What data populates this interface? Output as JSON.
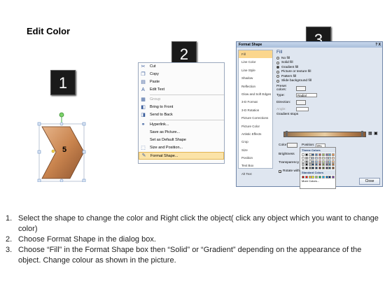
{
  "title": "Edit Color",
  "steps": [
    "1",
    "2",
    "3"
  ],
  "shape_label": "5",
  "context_menu": {
    "items": [
      {
        "label": "Cut",
        "icon": "scissors-icon",
        "disabled": false
      },
      {
        "label": "Copy",
        "icon": "copy-icon",
        "disabled": false
      },
      {
        "label": "Paste",
        "icon": "paste-icon",
        "disabled": false
      },
      {
        "label": "Edit Text",
        "icon": "edit-text-icon",
        "disabled": false
      },
      {
        "label": "Group",
        "icon": "group-icon",
        "disabled": true
      },
      {
        "label": "Bring to Front",
        "icon": "bring-front-icon",
        "disabled": false
      },
      {
        "label": "Send to Back",
        "icon": "send-back-icon",
        "disabled": false
      },
      {
        "label": "Hyperlink...",
        "icon": "hyperlink-icon",
        "disabled": false
      },
      {
        "label": "Save as Picture...",
        "icon": "",
        "disabled": false
      },
      {
        "label": "Set as Default Shape",
        "icon": "",
        "disabled": false
      },
      {
        "label": "Size and Position...",
        "icon": "size-icon",
        "disabled": false
      },
      {
        "label": "Format Shape...",
        "icon": "format-shape-icon",
        "disabled": false,
        "highlighted": true
      }
    ]
  },
  "dialog": {
    "title": "Format Shape",
    "controls": "? X",
    "left_items": [
      "Fill",
      "Line Color",
      "Line Style",
      "Shadow",
      "Reflection",
      "Glow and Soft Edges",
      "3-D Format",
      "3-D Rotation",
      "Picture Corrections",
      "Picture Color",
      "Artistic Effects",
      "Crop",
      "Size",
      "Position",
      "Text Box",
      "Alt Text"
    ],
    "section_heading": "Fill",
    "fill_options": [
      {
        "label": "No fill",
        "selected": false
      },
      {
        "label": "Solid fill",
        "selected": false
      },
      {
        "label": "Gradient fill",
        "selected": true
      },
      {
        "label": "Picture or texture fill",
        "selected": false
      },
      {
        "label": "Pattern fill",
        "selected": false
      },
      {
        "label": "Slide background fill",
        "selected": false
      }
    ],
    "preset_colors_label": "Preset colors:",
    "type_label": "Type:",
    "type_value": "Radial",
    "direction_label": "Direction:",
    "angle_label": "Angle:",
    "gradient_stops_label": "Gradient stops",
    "color_label": "Color",
    "position_label": "Position:",
    "position_value": "0%",
    "brightness_label": "Brightness",
    "transparency_label": "Transparency",
    "rotate_label": "Rotate with shape",
    "close_label": "Close"
  },
  "palette": {
    "theme_heading": "Theme Colors",
    "standard_heading": "Standard Colors",
    "more_label": "More Colors...",
    "theme_colors": [
      "#ffffff",
      "#000000",
      "#eeece1",
      "#1f497d",
      "#4f81bd",
      "#c0504d",
      "#9bbb59",
      "#8064a2",
      "#4bacc6",
      "#f79646"
    ],
    "standard_colors": [
      "#c00000",
      "#ff0000",
      "#ffc000",
      "#ffff00",
      "#92d050",
      "#00b050",
      "#00b0f0",
      "#0070c0",
      "#002060",
      "#7030a0"
    ]
  },
  "instructions": [
    {
      "num": "1.",
      "text": "Select the shape to change the color and Right click the object( click any object which you want to change color)"
    },
    {
      "num": "2.",
      "text": "Choose Format Shape in the dialog box."
    },
    {
      "num": "3.",
      "text": "Choose “Fill” in the Format Shape box then “Solid” or “Gradient” depending on the appearance of the object. Change colour as shown in the picture."
    }
  ]
}
